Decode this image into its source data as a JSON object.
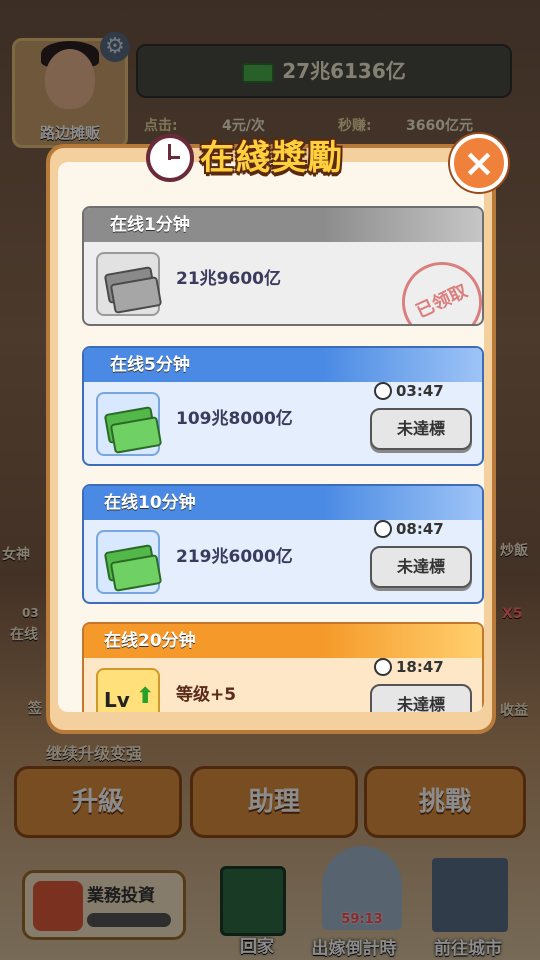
{
  "hud": {
    "player_name": "路边摊贩",
    "money_total": "27兆6136亿",
    "click_label": "点击:",
    "click_value": "4元/次",
    "per_sec_label": "秒赚:",
    "per_sec_value": "3660亿元"
  },
  "background": {
    "left_labels": [
      "女神",
      "在线",
      "签"
    ],
    "left_timer": "03",
    "right_labels": [
      "炒飯",
      "X5",
      "收益"
    ],
    "upgrade_hint": "继续升级变强",
    "buttons": {
      "upgrade": "升級",
      "assistant": "助理",
      "challenge": "挑戰"
    },
    "bottom_nav": {
      "investment": "業務投資",
      "home": "回家",
      "marriage": "出嫁倒計時",
      "marriage_timer": "59:13",
      "city": "前往城市"
    }
  },
  "modal": {
    "title": "在綫獎勵",
    "close": "×",
    "rewards": [
      {
        "name": "在线1分钟",
        "amount": "21兆9600亿",
        "state": "claimed",
        "stamp": "已领取",
        "icon": "cash-gray-icon"
      },
      {
        "name": "在线5分钟",
        "amount": "109兆8000亿",
        "timer": "03:47",
        "status": "未達標",
        "icon": "cash-green-icon"
      },
      {
        "name": "在线10分钟",
        "amount": "219兆6000亿",
        "timer": "08:47",
        "status": "未達標",
        "icon": "cash-green-icon"
      },
      {
        "name": "在线20分钟",
        "amount": "等级+5",
        "timer": "18:47",
        "status": "未達標",
        "icon": "level-up-icon",
        "icon_text": "Lv"
      }
    ]
  },
  "colors": {
    "gray_header": "#8c8c8c",
    "blue_header": "#4a8ae4",
    "orange_header": "#f59a2a",
    "close_button": "#f0813a",
    "title_fill": "#ffcf3e"
  }
}
